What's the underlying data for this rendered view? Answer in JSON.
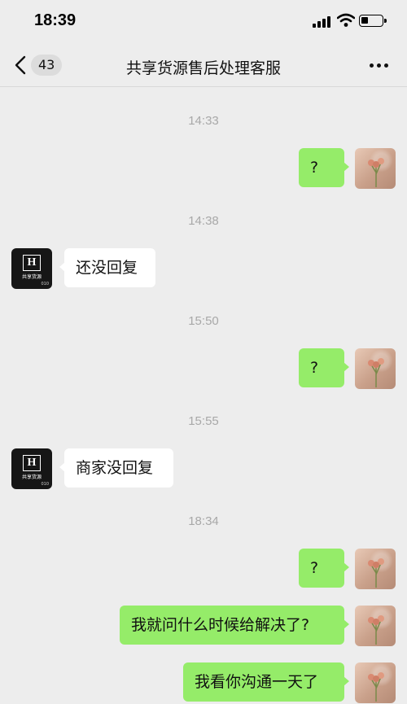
{
  "status_bar": {
    "time": "18:39"
  },
  "header": {
    "unread_count": "43",
    "title": "共享货源售后处理客服"
  },
  "avatars": {
    "merchant_brand": "共享货源",
    "merchant_code": "010"
  },
  "messages": [
    {
      "type": "time",
      "text": "14:33"
    },
    {
      "type": "sent",
      "text": "?"
    },
    {
      "type": "time",
      "text": "14:38"
    },
    {
      "type": "received",
      "text": "还没回复"
    },
    {
      "type": "time",
      "text": "15:50"
    },
    {
      "type": "sent",
      "text": "?"
    },
    {
      "type": "time",
      "text": "15:55"
    },
    {
      "type": "received",
      "text": "商家没回复"
    },
    {
      "type": "time",
      "text": "18:34"
    },
    {
      "type": "sent",
      "text": "?"
    },
    {
      "type": "sent",
      "text": "我就问什么时候给解决了?"
    },
    {
      "type": "sent",
      "text": "我看你沟通一天了"
    }
  ]
}
